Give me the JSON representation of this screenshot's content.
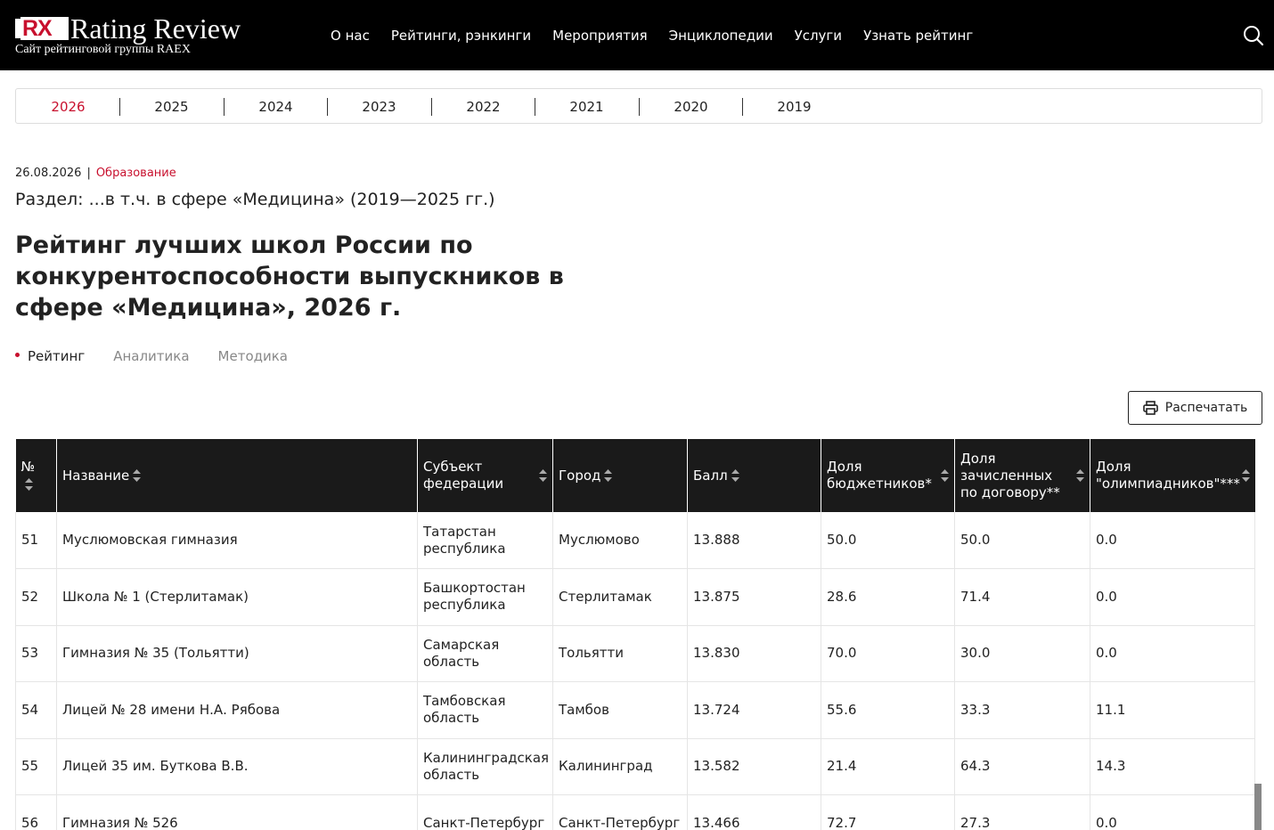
{
  "header": {
    "logo_mark": "RX",
    "logo_text": "Rating Review",
    "logo_sub": "Сайт рейтинговой группы RAEX",
    "nav": [
      "О нас",
      "Рейтинги, рэнкинги",
      "Мероприятия",
      "Энциклопедии",
      "Услуги",
      "Узнать рейтинг"
    ]
  },
  "years": [
    "2026",
    "2025",
    "2024",
    "2023",
    "2022",
    "2021",
    "2020",
    "2019"
  ],
  "active_year": "2026",
  "meta": {
    "date": "26.08.2026",
    "category": "Образование"
  },
  "section": "Раздел: ...в т.ч. в сфере «Медицина» (2019—2025 гг.)",
  "title": "Рейтинг лучших школ России по конкурентоспособности выпускников в сфере «Медицина», 2026 г.",
  "tabs": [
    "Рейтинг",
    "Аналитика",
    "Методика"
  ],
  "print_label": "Распечатать",
  "table": {
    "headers": [
      "№",
      "Название",
      "Субъект федерации",
      "Город",
      "Балл",
      "Доля бюджетников*",
      "Доля зачисленных по договору**",
      "Доля \"олимпиадников\"***"
    ],
    "rows": [
      [
        "51",
        "Муслюмовская гимназия",
        "Татарстан республика",
        "Муслюмово",
        "13.888",
        "50.0",
        "50.0",
        "0.0"
      ],
      [
        "52",
        "Школа № 1 (Стерлитамак)",
        "Башкортостан республика",
        "Стерлитамак",
        "13.875",
        "28.6",
        "71.4",
        "0.0"
      ],
      [
        "53",
        "Гимназия № 35 (Тольятти)",
        "Самарская область",
        "Тольятти",
        "13.830",
        "70.0",
        "30.0",
        "0.0"
      ],
      [
        "54",
        "Лицей № 28 имени Н.А. Рябова",
        "Тамбовская область",
        "Тамбов",
        "13.724",
        "55.6",
        "33.3",
        "11.1"
      ],
      [
        "55",
        "Лицей 35 им. Буткова В.В.",
        "Калининградская область",
        "Калининград",
        "13.582",
        "21.4",
        "64.3",
        "14.3"
      ],
      [
        "56",
        "Гимназия № 526",
        "Санкт-Петербург",
        "Санкт-Петербург",
        "13.466",
        "72.7",
        "27.3",
        "0.0"
      ]
    ]
  },
  "colors": {
    "accent": "#c8102e",
    "header_bg": "#000000",
    "table_head_bg": "#1a1a1a"
  }
}
